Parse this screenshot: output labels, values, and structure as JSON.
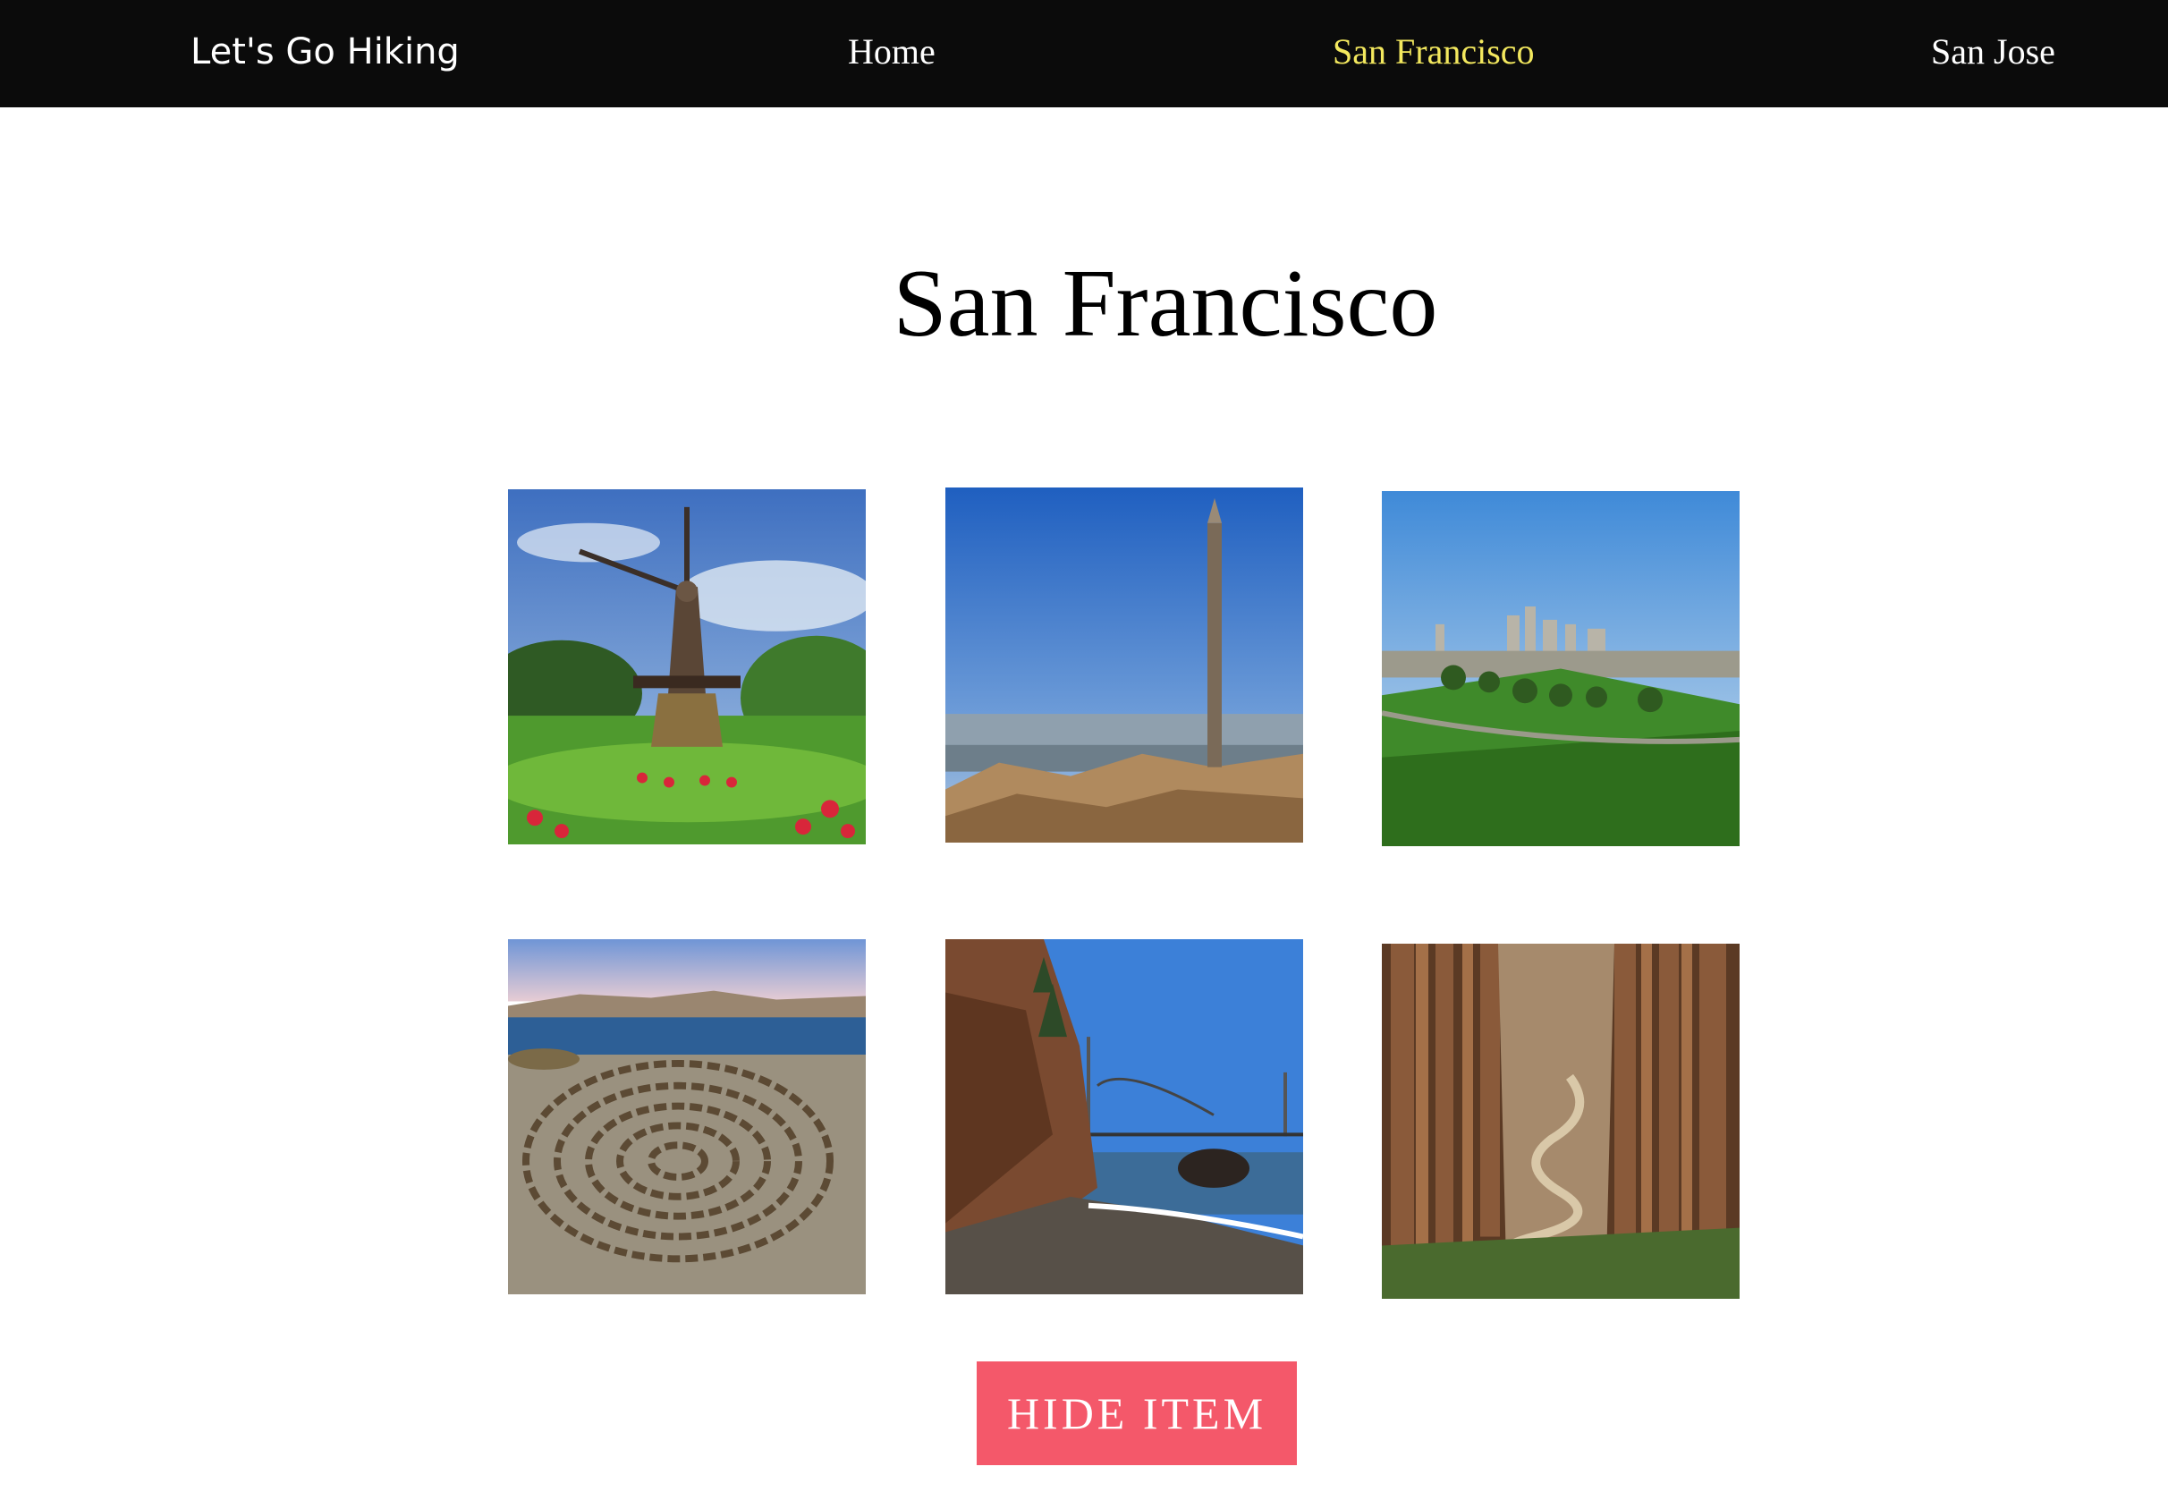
{
  "nav": {
    "brand": "Let's Go Hiking",
    "links": [
      {
        "label": "Home",
        "active": false
      },
      {
        "label": "San Francisco",
        "active": true
      },
      {
        "label": "San Jose",
        "active": false
      }
    ],
    "active_color": "#f3e85e"
  },
  "page": {
    "title": "San Francisco"
  },
  "gallery": {
    "images": [
      {
        "subject": "windmill-garden-photo"
      },
      {
        "subject": "rock-pole-sea-view-photo"
      },
      {
        "subject": "city-park-skyline-photo"
      },
      {
        "subject": "stone-labyrinth-photo"
      },
      {
        "subject": "beach-bridge-cliff-photo"
      },
      {
        "subject": "eucalyptus-forest-path-photo"
      }
    ]
  },
  "actions": {
    "hide_label": "HIDE ITEM",
    "hide_color": "#f4586a"
  }
}
